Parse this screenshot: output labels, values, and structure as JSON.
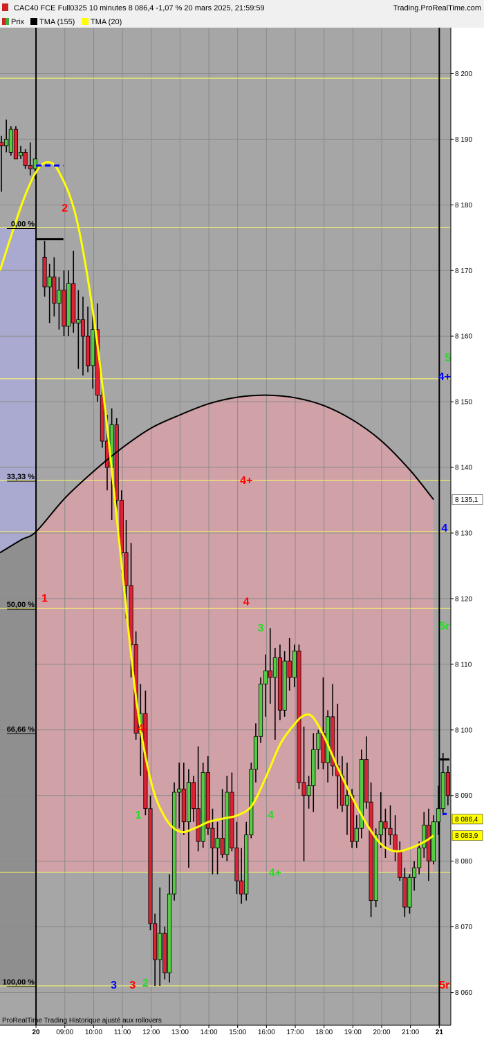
{
  "header": {
    "title": "CAC40 FCE Full0325 10 minutes 8 086,4 -1,07 % 20 mars 2025, 21:59:59",
    "brand": "Trading.ProRealTime.com"
  },
  "legend": [
    {
      "label": "Prix",
      "color": "#c0392b"
    },
    {
      "label": "TMA (155)",
      "color": "#000000"
    },
    {
      "label": "TMA (20)",
      "color": "#ffff00"
    }
  ],
  "footer": {
    "note": "ProRealTime Trading  Historique ajusté aux rollovers"
  },
  "colors": {
    "plot_bg": "#a6a6a6",
    "up_candle": "#55cc44",
    "down_candle": "#dd2233",
    "tma155": "#000000",
    "tma20": "#ffff00",
    "fib_line": "#ffff66",
    "blue_zone": "#b0b0e0",
    "red_zone": "#d8a0a8",
    "last_price_bg": "#ffff00"
  },
  "price_labels": {
    "last": "8 086,4",
    "tma20": "8 083,9",
    "tma155": "8 135,1"
  },
  "chart_data": {
    "type": "candlestick",
    "title": "CAC40 FCE Full0325 10 minutes",
    "ylim": [
      8055,
      8207
    ],
    "y_ticks": [
      {
        "value": 8060,
        "label": "8 060"
      },
      {
        "value": 8070,
        "label": "8 070"
      },
      {
        "value": 8080,
        "label": "8 080"
      },
      {
        "value": 8090,
        "label": "8 090"
      },
      {
        "value": 8100,
        "label": "8 100"
      },
      {
        "value": 8110,
        "label": "8 110"
      },
      {
        "value": 8120,
        "label": "8 120"
      },
      {
        "value": 8130,
        "label": "8 130"
      },
      {
        "value": 8140,
        "label": "8 140"
      },
      {
        "value": 8150,
        "label": "8 150"
      },
      {
        "value": 8160,
        "label": "8 160"
      },
      {
        "value": 8170,
        "label": "8 170"
      },
      {
        "value": 8180,
        "label": "8 180"
      },
      {
        "value": 8190,
        "label": "8 190"
      },
      {
        "value": 8200,
        "label": "8 200"
      }
    ],
    "x_ticks": [
      {
        "time": 8.0,
        "label": "20",
        "bold": true
      },
      {
        "time": 9.0,
        "label": "09:00"
      },
      {
        "time": 10.0,
        "label": "10:00"
      },
      {
        "time": 11.0,
        "label": "11:00"
      },
      {
        "time": 12.0,
        "label": "12:00"
      },
      {
        "time": 13.0,
        "label": "13:00"
      },
      {
        "time": 14.0,
        "label": "14:00"
      },
      {
        "time": 15.0,
        "label": "15:00"
      },
      {
        "time": 16.0,
        "label": "16:00"
      },
      {
        "time": 17.0,
        "label": "17:00"
      },
      {
        "time": 18.0,
        "label": "18:00"
      },
      {
        "time": 19.0,
        "label": "19:00"
      },
      {
        "time": 20.0,
        "label": "20:00"
      },
      {
        "time": 21.0,
        "label": "21:00"
      },
      {
        "time": 22.0,
        "label": "21",
        "bold": true
      }
    ],
    "xlim": [
      6.75,
      22.4
    ],
    "day_separators": [
      8.0,
      22.0
    ],
    "fib_levels": [
      {
        "value": 8176.5,
        "label": "0,00 %"
      },
      {
        "value": 8138.0,
        "label": "33,33 %"
      },
      {
        "value": 8118.5,
        "label": "50,00 %"
      },
      {
        "value": 8099.5,
        "label": "66,66 %"
      },
      {
        "value": 8061.0,
        "label": "100,00 %"
      }
    ],
    "horizontal_lines": [
      8199.3,
      8176.5,
      8153.5,
      8138.0,
      8130.2,
      8118.5,
      8078.3,
      8061.0
    ],
    "wave_labels": [
      {
        "text": "2",
        "time": 9.0,
        "price": 8179.0,
        "color": "#ff0000"
      },
      {
        "text": "1",
        "time": 8.3,
        "price": 8119.5,
        "color": "#ff0000"
      },
      {
        "text": "4+",
        "time": 15.3,
        "price": 8137.5,
        "color": "#ff0000"
      },
      {
        "text": "4",
        "time": 15.3,
        "price": 8119.0,
        "color": "#ff0000"
      },
      {
        "text": "3",
        "time": 15.8,
        "price": 8115.0,
        "color": "#22dd22"
      },
      {
        "text": "4-",
        "time": 11.7,
        "price": 8099.7,
        "color": "#ff0000"
      },
      {
        "text": "1",
        "time": 11.55,
        "price": 8086.5,
        "color": "#22dd22"
      },
      {
        "text": "4",
        "time": 16.15,
        "price": 8086.5,
        "color": "#22dd22"
      },
      {
        "text": "4+",
        "time": 16.3,
        "price": 8077.7,
        "color": "#22dd22"
      },
      {
        "text": "3",
        "time": 10.7,
        "price": 8060.6,
        "color": "#0000ff"
      },
      {
        "text": "3",
        "time": 11.35,
        "price": 8060.6,
        "color": "#ff0000"
      },
      {
        "text": "2",
        "time": 11.8,
        "price": 8060.9,
        "color": "#22dd22"
      },
      {
        "text": "5",
        "time": 22.3,
        "price": 8156.2,
        "color": "#22dd22"
      },
      {
        "text": "4+",
        "time": 22.18,
        "price": 8153.3,
        "color": "#0000ff"
      },
      {
        "text": "4",
        "time": 22.18,
        "price": 8130.2,
        "color": "#0000ff"
      },
      {
        "text": "5r",
        "time": 22.18,
        "price": 8115.3,
        "color": "#22dd22"
      },
      {
        "text": "5r",
        "time": 22.18,
        "price": 8060.6,
        "color": "#ff0000"
      }
    ],
    "tma155": [
      [
        6.75,
        8127.0
      ],
      [
        7.5,
        8129.0
      ],
      [
        8.0,
        8130.2
      ],
      [
        9.0,
        8135.3
      ],
      [
        10.0,
        8139.4
      ],
      [
        11.0,
        8143.0
      ],
      [
        12.0,
        8146.0
      ],
      [
        13.0,
        8148.0
      ],
      [
        14.0,
        8149.7
      ],
      [
        15.0,
        8150.7
      ],
      [
        16.0,
        8151.0
      ],
      [
        17.0,
        8150.6
      ],
      [
        18.0,
        8149.4
      ],
      [
        19.0,
        8147.2
      ],
      [
        20.0,
        8144.0
      ],
      [
        21.0,
        8139.5
      ],
      [
        21.8,
        8135.1
      ]
    ],
    "tma20": [
      [
        6.75,
        8170.0
      ],
      [
        7.5,
        8180.0
      ],
      [
        8.0,
        8185.0
      ],
      [
        8.4,
        8186.5
      ],
      [
        8.8,
        8185.0
      ],
      [
        9.4,
        8178.0
      ],
      [
        10.0,
        8163.0
      ],
      [
        10.5,
        8145.0
      ],
      [
        11.0,
        8124.0
      ],
      [
        11.5,
        8104.0
      ],
      [
        12.0,
        8092.0
      ],
      [
        12.5,
        8086.5
      ],
      [
        13.0,
        8084.5
      ],
      [
        13.5,
        8085.0
      ],
      [
        14.0,
        8086.0
      ],
      [
        14.5,
        8086.5
      ],
      [
        15.0,
        8087.0
      ],
      [
        15.5,
        8088.5
      ],
      [
        16.0,
        8093.0
      ],
      [
        16.5,
        8098.0
      ],
      [
        17.0,
        8101.0
      ],
      [
        17.3,
        8102.2
      ],
      [
        17.6,
        8102.0
      ],
      [
        18.0,
        8099.0
      ],
      [
        18.5,
        8094.0
      ],
      [
        19.0,
        8089.5
      ],
      [
        19.5,
        8085.5
      ],
      [
        20.0,
        8082.5
      ],
      [
        20.5,
        8081.5
      ],
      [
        21.0,
        8082.0
      ],
      [
        21.5,
        8083.0
      ],
      [
        21.8,
        8083.9
      ]
    ],
    "candles": [
      {
        "t": 6.8,
        "o": 8189.5,
        "h": 8190.5,
        "l": 8182.0,
        "c": 8189.0
      },
      {
        "t": 6.97,
        "o": 8189.0,
        "h": 8193.0,
        "l": 8188.0,
        "c": 8190.0
      },
      {
        "t": 7.13,
        "o": 8188.0,
        "h": 8192.0,
        "l": 8187.5,
        "c": 8191.5
      },
      {
        "t": 7.3,
        "o": 8191.5,
        "h": 8192.0,
        "l": 8187.0,
        "c": 8187.0
      },
      {
        "t": 7.47,
        "o": 8187.5,
        "h": 8189.0,
        "l": 8187.0,
        "c": 8188.0
      },
      {
        "t": 7.63,
        "o": 8188.0,
        "h": 8188.5,
        "l": 8185.5,
        "c": 8186.0
      },
      {
        "t": 7.8,
        "o": 8186.0,
        "h": 8189.5,
        "l": 8184.5,
        "c": 8185.5
      },
      {
        "t": 7.97,
        "o": 8185.5,
        "h": 8187.0,
        "l": 8184.0,
        "c": 8187.0
      },
      {
        "t": 8.3,
        "o": 8172.0,
        "h": 8174.5,
        "l": 8166.0,
        "c": 8167.5
      },
      {
        "t": 8.47,
        "o": 8167.5,
        "h": 8171.0,
        "l": 8162.0,
        "c": 8169.0
      },
      {
        "t": 8.63,
        "o": 8169.0,
        "h": 8172.0,
        "l": 8163.0,
        "c": 8165.0
      },
      {
        "t": 8.8,
        "o": 8165.0,
        "h": 8169.0,
        "l": 8161.0,
        "c": 8167.0
      },
      {
        "t": 8.97,
        "o": 8167.0,
        "h": 8170.0,
        "l": 8160.0,
        "c": 8161.5
      },
      {
        "t": 9.13,
        "o": 8161.5,
        "h": 8170.0,
        "l": 8160.0,
        "c": 8168.0
      },
      {
        "t": 9.3,
        "o": 8168.0,
        "h": 8173.0,
        "l": 8160.5,
        "c": 8162.0
      },
      {
        "t": 9.47,
        "o": 8162.0,
        "h": 8167.0,
        "l": 8155.0,
        "c": 8162.5
      },
      {
        "t": 9.63,
        "o": 8162.5,
        "h": 8166.0,
        "l": 8154.0,
        "c": 8160.0
      },
      {
        "t": 9.8,
        "o": 8160.0,
        "h": 8164.5,
        "l": 8154.5,
        "c": 8155.5
      },
      {
        "t": 9.97,
        "o": 8155.5,
        "h": 8164.0,
        "l": 8152.0,
        "c": 8161.0
      },
      {
        "t": 10.13,
        "o": 8161.0,
        "h": 8165.0,
        "l": 8150.0,
        "c": 8151.0
      },
      {
        "t": 10.3,
        "o": 8151.0,
        "h": 8153.0,
        "l": 8143.0,
        "c": 8144.0
      },
      {
        "t": 10.47,
        "o": 8144.0,
        "h": 8148.0,
        "l": 8136.5,
        "c": 8140.0
      },
      {
        "t": 10.63,
        "o": 8140.0,
        "h": 8149.0,
        "l": 8132.0,
        "c": 8146.5
      },
      {
        "t": 10.8,
        "o": 8146.5,
        "h": 8147.5,
        "l": 8132.0,
        "c": 8135.0
      },
      {
        "t": 10.97,
        "o": 8135.0,
        "h": 8136.5,
        "l": 8124.0,
        "c": 8127.0
      },
      {
        "t": 11.13,
        "o": 8127.0,
        "h": 8132.0,
        "l": 8117.0,
        "c": 8122.0
      },
      {
        "t": 11.3,
        "o": 8122.0,
        "h": 8128.5,
        "l": 8108.0,
        "c": 8113.0
      },
      {
        "t": 11.47,
        "o": 8113.0,
        "h": 8115.0,
        "l": 8098.5,
        "c": 8099.5
      },
      {
        "t": 11.63,
        "o": 8099.5,
        "h": 8107.0,
        "l": 8093.0,
        "c": 8102.5
      },
      {
        "t": 11.8,
        "o": 8102.5,
        "h": 8106.0,
        "l": 8087.0,
        "c": 8088.0
      },
      {
        "t": 11.97,
        "o": 8088.0,
        "h": 8090.0,
        "l": 8069.5,
        "c": 8070.5
      },
      {
        "t": 12.13,
        "o": 8070.5,
        "h": 8072.0,
        "l": 8061.0,
        "c": 8065.0
      },
      {
        "t": 12.3,
        "o": 8065.0,
        "h": 8076.0,
        "l": 8061.0,
        "c": 8069.0
      },
      {
        "t": 12.47,
        "o": 8069.0,
        "h": 8070.0,
        "l": 8062.0,
        "c": 8063.0
      },
      {
        "t": 12.63,
        "o": 8063.0,
        "h": 8078.0,
        "l": 8061.5,
        "c": 8075.0
      },
      {
        "t": 12.8,
        "o": 8075.0,
        "h": 8092.0,
        "l": 8074.0,
        "c": 8090.5
      },
      {
        "t": 12.97,
        "o": 8090.5,
        "h": 8095.0,
        "l": 8085.0,
        "c": 8091.0
      },
      {
        "t": 13.13,
        "o": 8091.0,
        "h": 8095.0,
        "l": 8084.0,
        "c": 8086.0
      },
      {
        "t": 13.3,
        "o": 8086.0,
        "h": 8094.0,
        "l": 8079.0,
        "c": 8092.0
      },
      {
        "t": 13.47,
        "o": 8092.0,
        "h": 8093.0,
        "l": 8086.0,
        "c": 8088.0
      },
      {
        "t": 13.63,
        "o": 8088.0,
        "h": 8097.5,
        "l": 8081.5,
        "c": 8083.0
      },
      {
        "t": 13.8,
        "o": 8083.0,
        "h": 8095.0,
        "l": 8082.0,
        "c": 8093.5
      },
      {
        "t": 13.97,
        "o": 8093.5,
        "h": 8096.0,
        "l": 8084.0,
        "c": 8085.0
      },
      {
        "t": 14.13,
        "o": 8085.0,
        "h": 8088.0,
        "l": 8078.0,
        "c": 8082.0
      },
      {
        "t": 14.3,
        "o": 8082.0,
        "h": 8086.0,
        "l": 8078.0,
        "c": 8083.5
      },
      {
        "t": 14.47,
        "o": 8083.5,
        "h": 8091.0,
        "l": 8080.5,
        "c": 8081.0
      },
      {
        "t": 14.63,
        "o": 8081.0,
        "h": 8093.0,
        "l": 8080.0,
        "c": 8090.5
      },
      {
        "t": 14.8,
        "o": 8090.5,
        "h": 8093.5,
        "l": 8081.5,
        "c": 8082.0
      },
      {
        "t": 14.97,
        "o": 8082.0,
        "h": 8086.0,
        "l": 8075.0,
        "c": 8077.0
      },
      {
        "t": 15.13,
        "o": 8077.0,
        "h": 8082.0,
        "l": 8073.5,
        "c": 8075.0
      },
      {
        "t": 15.3,
        "o": 8075.0,
        "h": 8086.0,
        "l": 8074.0,
        "c": 8084.0
      },
      {
        "t": 15.47,
        "o": 8084.0,
        "h": 8095.0,
        "l": 8083.5,
        "c": 8094.0
      },
      {
        "t": 15.63,
        "o": 8094.0,
        "h": 8101.0,
        "l": 8092.0,
        "c": 8099.0
      },
      {
        "t": 15.8,
        "o": 8099.0,
        "h": 8108.0,
        "l": 8098.0,
        "c": 8107.0
      },
      {
        "t": 15.97,
        "o": 8107.0,
        "h": 8111.5,
        "l": 8102.0,
        "c": 8109.0
      },
      {
        "t": 16.13,
        "o": 8109.0,
        "h": 8115.5,
        "l": 8104.0,
        "c": 8108.0
      },
      {
        "t": 16.3,
        "o": 8108.0,
        "h": 8112.5,
        "l": 8098.5,
        "c": 8111.0
      },
      {
        "t": 16.47,
        "o": 8111.0,
        "h": 8113.0,
        "l": 8101.5,
        "c": 8103.0
      },
      {
        "t": 16.63,
        "o": 8103.0,
        "h": 8112.0,
        "l": 8102.0,
        "c": 8110.5
      },
      {
        "t": 16.8,
        "o": 8110.5,
        "h": 8114.0,
        "l": 8106.0,
        "c": 8108.0
      },
      {
        "t": 16.97,
        "o": 8108.0,
        "h": 8113.0,
        "l": 8106.5,
        "c": 8112.0
      },
      {
        "t": 17.13,
        "o": 8112.0,
        "h": 8113.0,
        "l": 8091.0,
        "c": 8092.0
      },
      {
        "t": 17.3,
        "o": 8092.0,
        "h": 8100.5,
        "l": 8080.0,
        "c": 8090.0
      },
      {
        "t": 17.47,
        "o": 8090.0,
        "h": 8093.0,
        "l": 8088.0,
        "c": 8091.5
      },
      {
        "t": 17.63,
        "o": 8091.5,
        "h": 8099.5,
        "l": 8087.5,
        "c": 8097.0
      },
      {
        "t": 17.8,
        "o": 8097.0,
        "h": 8100.0,
        "l": 8094.0,
        "c": 8099.5
      },
      {
        "t": 17.97,
        "o": 8099.5,
        "h": 8108.0,
        "l": 8094.0,
        "c": 8095.0
      },
      {
        "t": 18.13,
        "o": 8095.0,
        "h": 8103.0,
        "l": 8092.0,
        "c": 8102.0
      },
      {
        "t": 18.3,
        "o": 8102.0,
        "h": 8107.0,
        "l": 8093.0,
        "c": 8094.5
      },
      {
        "t": 18.47,
        "o": 8094.5,
        "h": 8104.0,
        "l": 8088.0,
        "c": 8093.0
      },
      {
        "t": 18.63,
        "o": 8093.0,
        "h": 8096.0,
        "l": 8087.5,
        "c": 8088.5
      },
      {
        "t": 18.8,
        "o": 8088.5,
        "h": 8095.0,
        "l": 8084.0,
        "c": 8090.0
      },
      {
        "t": 18.97,
        "o": 8090.0,
        "h": 8091.0,
        "l": 8082.0,
        "c": 8083.0
      },
      {
        "t": 19.13,
        "o": 8083.0,
        "h": 8087.0,
        "l": 8082.0,
        "c": 8085.0
      },
      {
        "t": 19.3,
        "o": 8085.0,
        "h": 8097.0,
        "l": 8083.5,
        "c": 8095.5
      },
      {
        "t": 19.47,
        "o": 8095.5,
        "h": 8099.0,
        "l": 8088.0,
        "c": 8089.0
      },
      {
        "t": 19.63,
        "o": 8089.0,
        "h": 8092.0,
        "l": 8071.5,
        "c": 8074.0
      },
      {
        "t": 19.8,
        "o": 8074.0,
        "h": 8085.0,
        "l": 8073.0,
        "c": 8084.0
      },
      {
        "t": 19.97,
        "o": 8084.0,
        "h": 8090.5,
        "l": 8082.0,
        "c": 8086.0
      },
      {
        "t": 20.13,
        "o": 8086.0,
        "h": 8088.0,
        "l": 8080.5,
        "c": 8085.0
      },
      {
        "t": 20.3,
        "o": 8085.0,
        "h": 8088.5,
        "l": 8082.5,
        "c": 8084.0
      },
      {
        "t": 20.47,
        "o": 8084.0,
        "h": 8087.0,
        "l": 8080.0,
        "c": 8081.5
      },
      {
        "t": 20.63,
        "o": 8081.5,
        "h": 8083.0,
        "l": 8077.0,
        "c": 8077.5
      },
      {
        "t": 20.8,
        "o": 8077.5,
        "h": 8079.0,
        "l": 8071.5,
        "c": 8073.0
      },
      {
        "t": 20.97,
        "o": 8073.0,
        "h": 8078.0,
        "l": 8072.0,
        "c": 8077.5
      },
      {
        "t": 21.13,
        "o": 8077.5,
        "h": 8080.0,
        "l": 8075.5,
        "c": 8079.0
      },
      {
        "t": 21.3,
        "o": 8079.0,
        "h": 8083.0,
        "l": 8078.0,
        "c": 8082.0
      },
      {
        "t": 21.47,
        "o": 8082.0,
        "h": 8087.5,
        "l": 8080.5,
        "c": 8085.5
      },
      {
        "t": 21.63,
        "o": 8085.5,
        "h": 8088.0,
        "l": 8077.0,
        "c": 8080.0
      },
      {
        "t": 21.8,
        "o": 8080.0,
        "h": 8087.0,
        "l": 8079.5,
        "c": 8086.0
      },
      {
        "t": 21.97,
        "o": 8086.0,
        "h": 8091.5,
        "l": 8084.0,
        "c": 8088.0
      },
      {
        "t": 22.13,
        "o": 8088.0,
        "h": 8096.5,
        "l": 8087.0,
        "c": 8093.5
      },
      {
        "t": 22.3,
        "o": 8093.5,
        "h": 8094.5,
        "l": 8088.5,
        "c": 8090.0
      }
    ]
  }
}
